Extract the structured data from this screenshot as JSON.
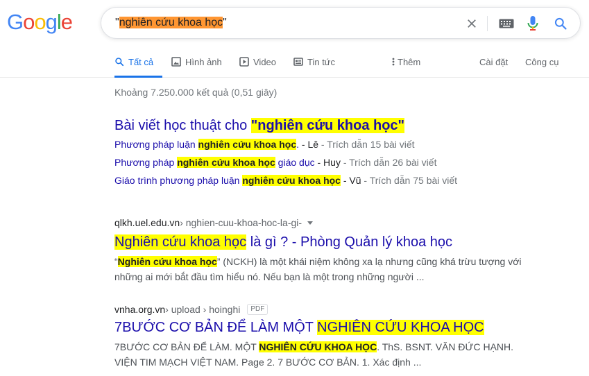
{
  "logo": {
    "letters": [
      "G",
      "o",
      "o",
      "g",
      "l",
      "e"
    ],
    "colors": [
      "#4285f4",
      "#ea4335",
      "#fbbc05",
      "#4285f4",
      "#34a853",
      "#ea4335"
    ]
  },
  "search": {
    "prefix": "\"",
    "highlight": "nghiên cứu khoa học",
    "suffix": "\""
  },
  "icons": {
    "clear": "close-icon",
    "keyboard": "keyboard-icon",
    "mic": "microphone-icon",
    "search": "search-icon"
  },
  "tabs": [
    {
      "label": "Tất cả",
      "icon": "search-icon",
      "active": true
    },
    {
      "label": "Hình ảnh",
      "icon": "image-icon"
    },
    {
      "label": "Video",
      "icon": "video-icon"
    },
    {
      "label": "Tin tức",
      "icon": "news-icon"
    },
    {
      "label": "Thêm",
      "icon": "more-vert-icon"
    },
    {
      "label": "Cài đặt"
    },
    {
      "label": "Công cụ"
    }
  ],
  "stats": "Khoảng 7.250.000 kết quả (0,51 giây)",
  "scholar": {
    "title_pre": "Bài viết học thuật cho ",
    "title_hl": "\"nghiên cứu khoa học\"",
    "rows": [
      {
        "pre": "Phương pháp luận ",
        "hl": "nghiên cứu khoa học",
        "post": ".",
        "author": " - Lê",
        "cited": " - Trích dẫn 15 bài viết"
      },
      {
        "pre": "Phương pháp ",
        "hl": "nghiên cứu khoa học",
        "post": " giáo dục",
        "author": " - Huy",
        "cited": " - Trích dẫn 26 bài viết"
      },
      {
        "pre": "Giáo trình phương pháp luận ",
        "hl": "nghiên cứu khoa học",
        "post": "",
        "author": " - Vũ",
        "cited": " - Trích dẫn 75 bài viết"
      }
    ]
  },
  "results": [
    {
      "domain": "qlkh.uel.edu.vn",
      "path": " › nghien-cuu-khoa-hoc-la-gi-",
      "title_hl": "Nghiên cứu khoa học",
      "title_rest": " là gì ? - Phòng Quản lý khoa học",
      "snip_pre": "“",
      "snip_hl": "Nghiên cứu khoa học",
      "snip_post": "” (NCKH) là một khái niệm không xa lạ nhưng cũng khá trừu tượng với những ai mới bắt đầu tìm hiểu nó. Nếu bạn là một trong những người ..."
    },
    {
      "domain": "vnha.org.vn",
      "path": " › upload › hoinghi",
      "badge": "PDF",
      "title_pre": "7BƯỚC CƠ BẢN ĐỂ LÀM MỘT ",
      "title_hl": "NGHIÊN CỨU KHOA HỌC",
      "snip_pre": "7BƯỚC CƠ BẢN ĐỂ LÀM. MỘT ",
      "snip_hl": "NGHIÊN CỨU KHOA HỌC",
      "snip_post": ". ThS. BSNT. VĂN ĐỨC HẠNH. VIỆN TIM MẠCH VIỆT NAM. Page 2. 7 BƯỚC CƠ BẢN. 1. Xác định ..."
    }
  ]
}
